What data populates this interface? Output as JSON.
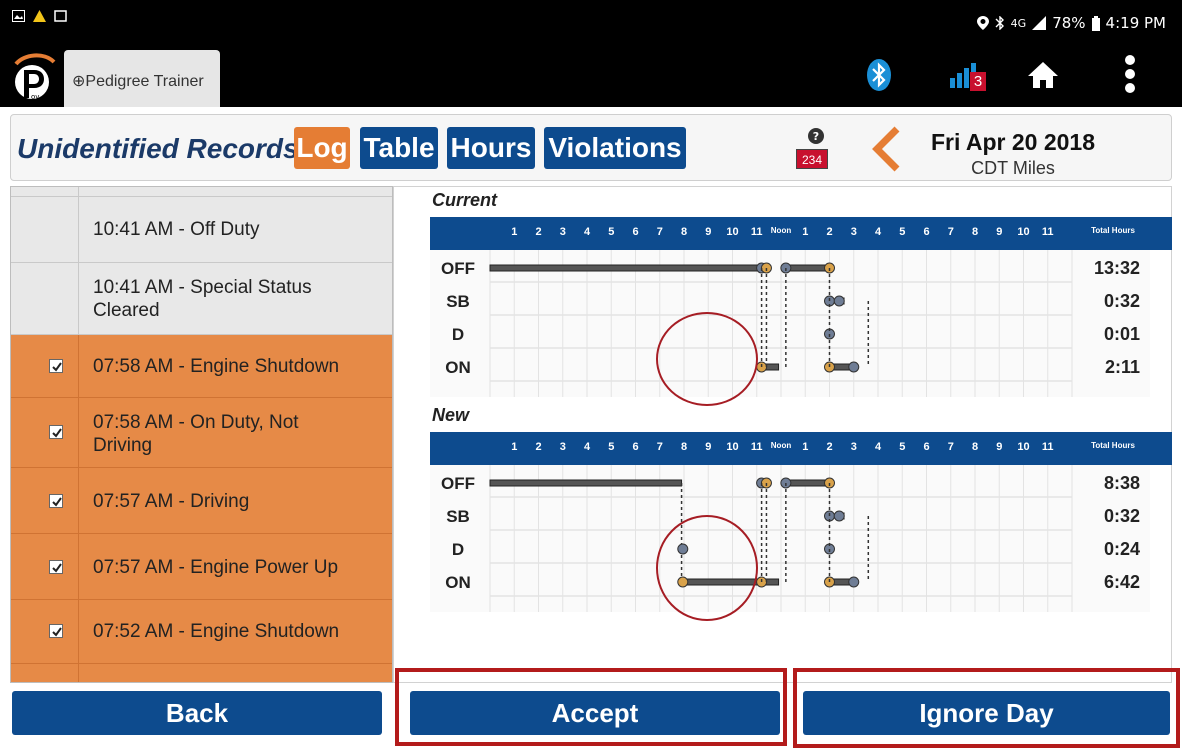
{
  "status_bar": {
    "battery": "78%",
    "time": "4:19 PM",
    "network": "4G"
  },
  "app_bar": {
    "tab_label": "⊕Pedigree Trainer",
    "signal_badge": "3"
  },
  "header": {
    "title": "Unidentified Records",
    "tabs": [
      "Log",
      "Table",
      "Hours",
      "Violations"
    ],
    "help_badge": "234",
    "date": "Fri Apr 20 2018",
    "subdate": "CDT  Miles"
  },
  "records": [
    {
      "label": "10:41 AM - Off Duty",
      "checked": false,
      "selected": false
    },
    {
      "label": "10:41 AM - Special Status Cleared",
      "checked": false,
      "selected": false
    },
    {
      "label": "07:58 AM - Engine Shutdown",
      "checked": true,
      "selected": true
    },
    {
      "label": "07:58 AM - On Duty, Not Driving",
      "checked": true,
      "selected": true
    },
    {
      "label": "07:57 AM - Driving",
      "checked": true,
      "selected": true
    },
    {
      "label": "07:57 AM - Engine Power Up",
      "checked": true,
      "selected": true
    },
    {
      "label": "07:52 AM - Engine Shutdown",
      "checked": true,
      "selected": true
    }
  ],
  "graphs": {
    "hours_header": [
      "1",
      "2",
      "3",
      "4",
      "5",
      "6",
      "7",
      "8",
      "9",
      "10",
      "11",
      "Noon",
      "1",
      "2",
      "3",
      "4",
      "5",
      "6",
      "7",
      "8",
      "9",
      "10",
      "11"
    ],
    "total_label": "Total Hours",
    "status_rows": [
      "OFF",
      "SB",
      "D",
      "ON"
    ],
    "current": {
      "label": "Current",
      "totals": [
        "13:32",
        "0:32",
        "0:01",
        "2:11"
      ]
    },
    "new": {
      "label": "New",
      "totals": [
        "8:38",
        "0:32",
        "0:24",
        "6:42"
      ]
    }
  },
  "footer": {
    "back": "Back",
    "accept": "Accept",
    "ignore": "Ignore Day"
  },
  "colors": {
    "primary": "#0d4b8e",
    "accent": "#e57d34",
    "highlight": "#b31b1b"
  }
}
